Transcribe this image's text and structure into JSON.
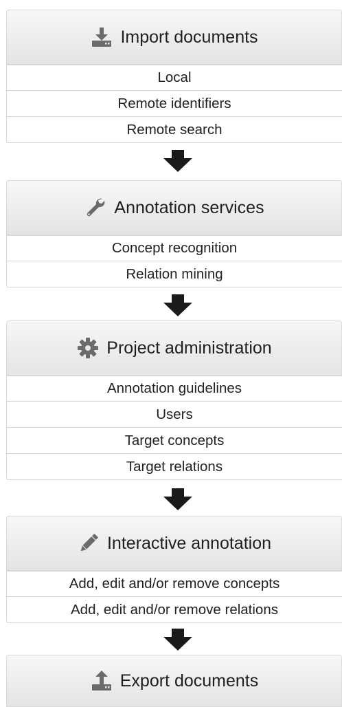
{
  "sections": [
    {
      "title": "Import documents",
      "icon": "download-icon",
      "items": [
        "Local",
        "Remote identifiers",
        "Remote search"
      ]
    },
    {
      "title": "Annotation services",
      "icon": "wrench-icon",
      "items": [
        "Concept recognition",
        "Relation mining"
      ]
    },
    {
      "title": "Project administration",
      "icon": "gear-icon",
      "items": [
        "Annotation guidelines",
        "Users",
        "Target concepts",
        "Target relations"
      ]
    },
    {
      "title": "Interactive annotation",
      "icon": "pencil-icon",
      "items": [
        "Add, edit and/or remove concepts",
        "Add, edit and/or remove relations"
      ]
    },
    {
      "title": "Export documents",
      "icon": "upload-icon",
      "items": []
    }
  ],
  "colors": {
    "icon": "#6b6b6b",
    "arrow": "#1a1a1a"
  }
}
